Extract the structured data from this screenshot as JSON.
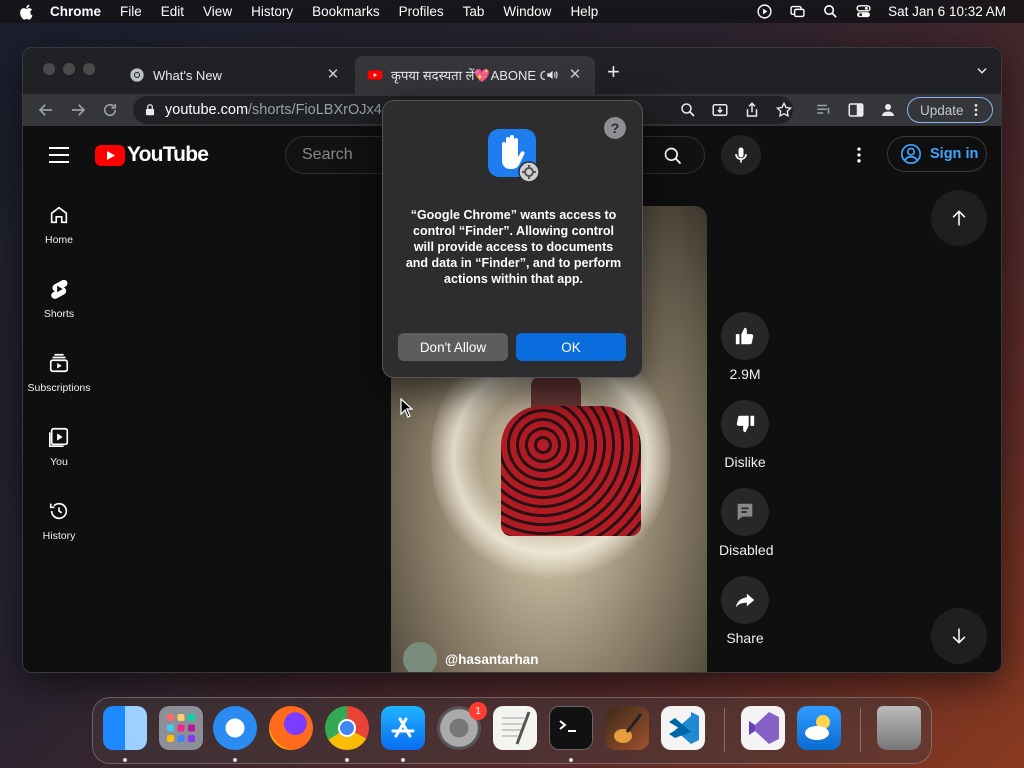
{
  "menubar": {
    "app": "Chrome",
    "items": [
      "File",
      "Edit",
      "View",
      "History",
      "Bookmarks",
      "Profiles",
      "Tab",
      "Window",
      "Help"
    ],
    "clock": "Sat Jan 6  10:32 AM"
  },
  "browser": {
    "tabs": [
      {
        "title": "What's New"
      },
      {
        "title": "कृपया सदस्यता लें💖ABONE OL"
      }
    ],
    "url_host": "youtube.com",
    "url_path": "/shorts/FioLBXrOJx4",
    "update_label": "Update"
  },
  "youtube": {
    "logo_text": "YouTube",
    "search_placeholder": "Search",
    "signin_label": "Sign in",
    "sidebar": [
      {
        "label": "Home"
      },
      {
        "label": "Shorts"
      },
      {
        "label": "Subscriptions"
      },
      {
        "label": "You"
      },
      {
        "label": "History"
      }
    ],
    "channel": "@hasantarhan",
    "actions": {
      "likes": "2.9M",
      "dislike": "Dislike",
      "comments": "Disabled",
      "share": "Share"
    }
  },
  "dialog": {
    "message": "“Google Chrome” wants access to control “Finder”. Allowing control will provide access to documents and data in “Finder”, and to perform actions within that app.",
    "deny_label": "Don't Allow",
    "ok_label": "OK",
    "help_label": "?"
  },
  "dock": {
    "settings_badge": "1"
  },
  "colors": {
    "yt_red": "#ff0000",
    "link_blue": "#3ea6ff",
    "dialog_ok": "#0a6cdd",
    "dialog_bg": "#2d2d2f"
  }
}
